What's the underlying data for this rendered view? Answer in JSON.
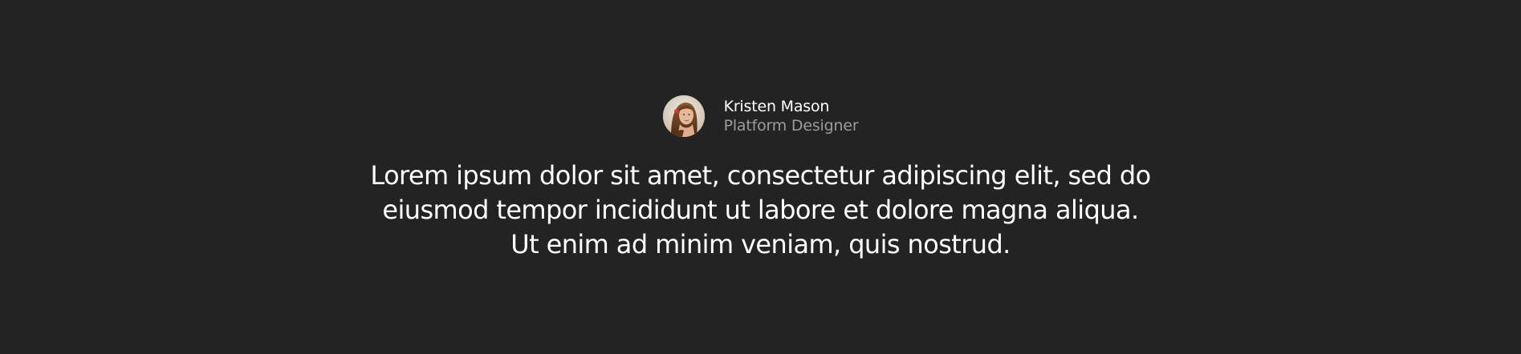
{
  "testimonial": {
    "author": {
      "name": "Kristen Mason",
      "role": "Platform Designer",
      "avatar_icon": "avatar-photo-icon"
    },
    "quote_lines": [
      "Lorem ipsum dolor sit amet, consectetur adipiscing elit, sed do",
      "eiusmod tempor incididunt ut labore et dolore magna aliqua.",
      "Ut enim ad minim veniam, quis nostrud."
    ]
  },
  "colors": {
    "background": "#232323",
    "primary_text": "#ffffff",
    "secondary_text": "#9b9b9b"
  }
}
